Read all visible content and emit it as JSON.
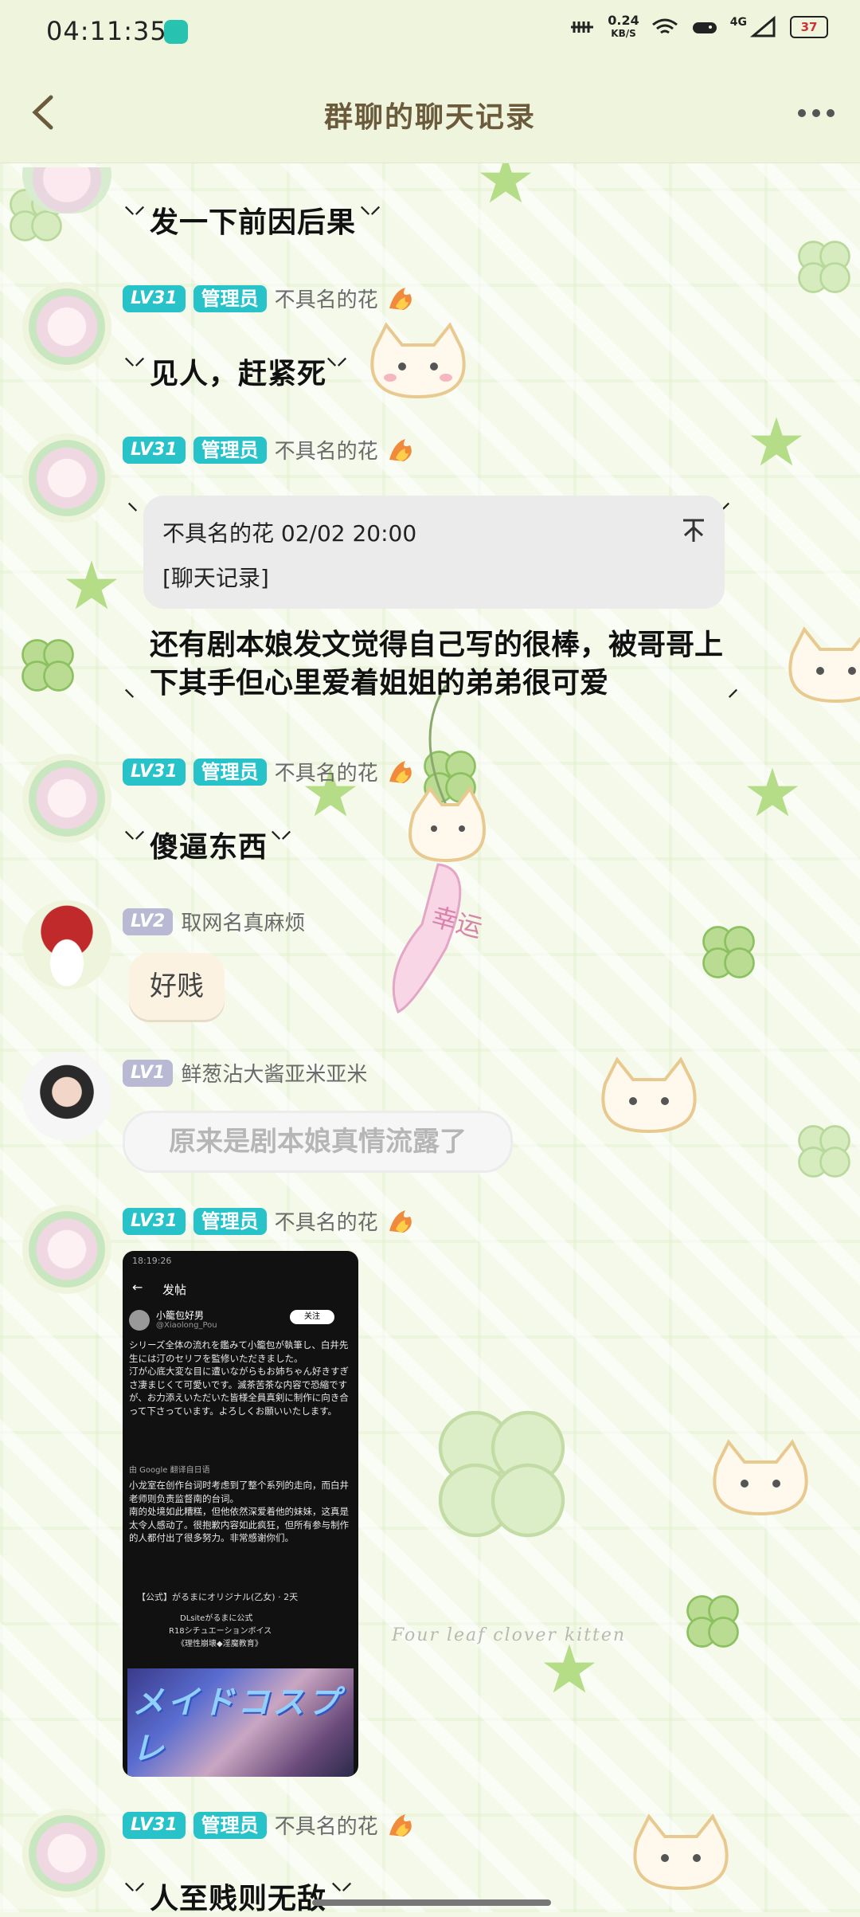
{
  "status_bar": {
    "time": "04:11:35",
    "speed_value": "0.24",
    "speed_unit": "KB/S",
    "network": "4G",
    "battery": "37"
  },
  "header": {
    "title": "群聊的聊天记录",
    "back_icon": "chevron-left-icon",
    "more_icon": "more-dots-icon"
  },
  "messages": [
    {
      "text": "发一下前因后果"
    },
    {
      "level": "LV31",
      "role": "管理员",
      "name": "不具名的花",
      "text": "见人，赶紧死"
    },
    {
      "level": "LV31",
      "role": "管理员",
      "name": "不具名的花",
      "quote_author": "不具名的花 02/02 20:00",
      "quote_body": "[聊天记录]",
      "text": "还有剧本娘发文觉得自己写的很棒，被哥哥上下其手但心里爱着姐姐的弟弟很可爱"
    },
    {
      "level": "LV31",
      "role": "管理员",
      "name": "不具名的花",
      "text": "傻逼东西"
    },
    {
      "level": "LV2",
      "name": "取网名真麻烦",
      "text": "好贱"
    },
    {
      "level": "LV1",
      "name": "鲜葱沾大酱亚米亚米",
      "text": "原来是剧本娘真情流露了"
    },
    {
      "level": "LV31",
      "role": "管理员",
      "name": "不具名的花",
      "image": {
        "status_time": "18:19:26",
        "page_title": "发帖",
        "user": "小籠包好男",
        "handle": "@Xiaolong_Pou",
        "follow": "关注",
        "body_jp": "シリーズ全体の流れを鑑みて小籠包が執筆し、白井先生には汀のセリフを監修いただきました。\n汀が心底大変な目に遭いながらもお姉ちゃん好きすぎさ凄まじくて可愛いです。滅茶苦茶な内容で恐縮ですが、お力添えいただいた皆様全員真剣に制作に向き合って下さっています。よろしくお願いいたします。",
        "translate": "由 Google 翻译自日语",
        "body_zh": "小龙室在创作台词时考虑到了整个系列的走向，而白井老师则负责监督南的台词。\n南的处境如此糟糕，但他依然深爱着他的妹妹，这真是太令人感动了。很抱歉内容如此疯狂，但所有参与制作的人都付出了很多努力。非常感谢你们。",
        "quoted_account": "【公式】がるまにオリジナル(乙女)",
        "quoted_time": "2天",
        "quoted_line1": "DLsiteがるまに公式",
        "quoted_line2": "R18シチュエーションボイス",
        "quoted_line3": "《理性崩壊◆淫魔教育》",
        "art_text": "メイドコスプレ"
      }
    },
    {
      "level": "LV31",
      "role": "管理员",
      "name": "不具名的花",
      "text": "人至贱则无敌"
    }
  ],
  "background": {
    "watermark": "Four leaf clover kitten",
    "charm_text": "幸运"
  },
  "colors": {
    "accent_level": "#28c3c9",
    "low_level": "#b9b9d3",
    "header_bg": "#eef5dc"
  }
}
